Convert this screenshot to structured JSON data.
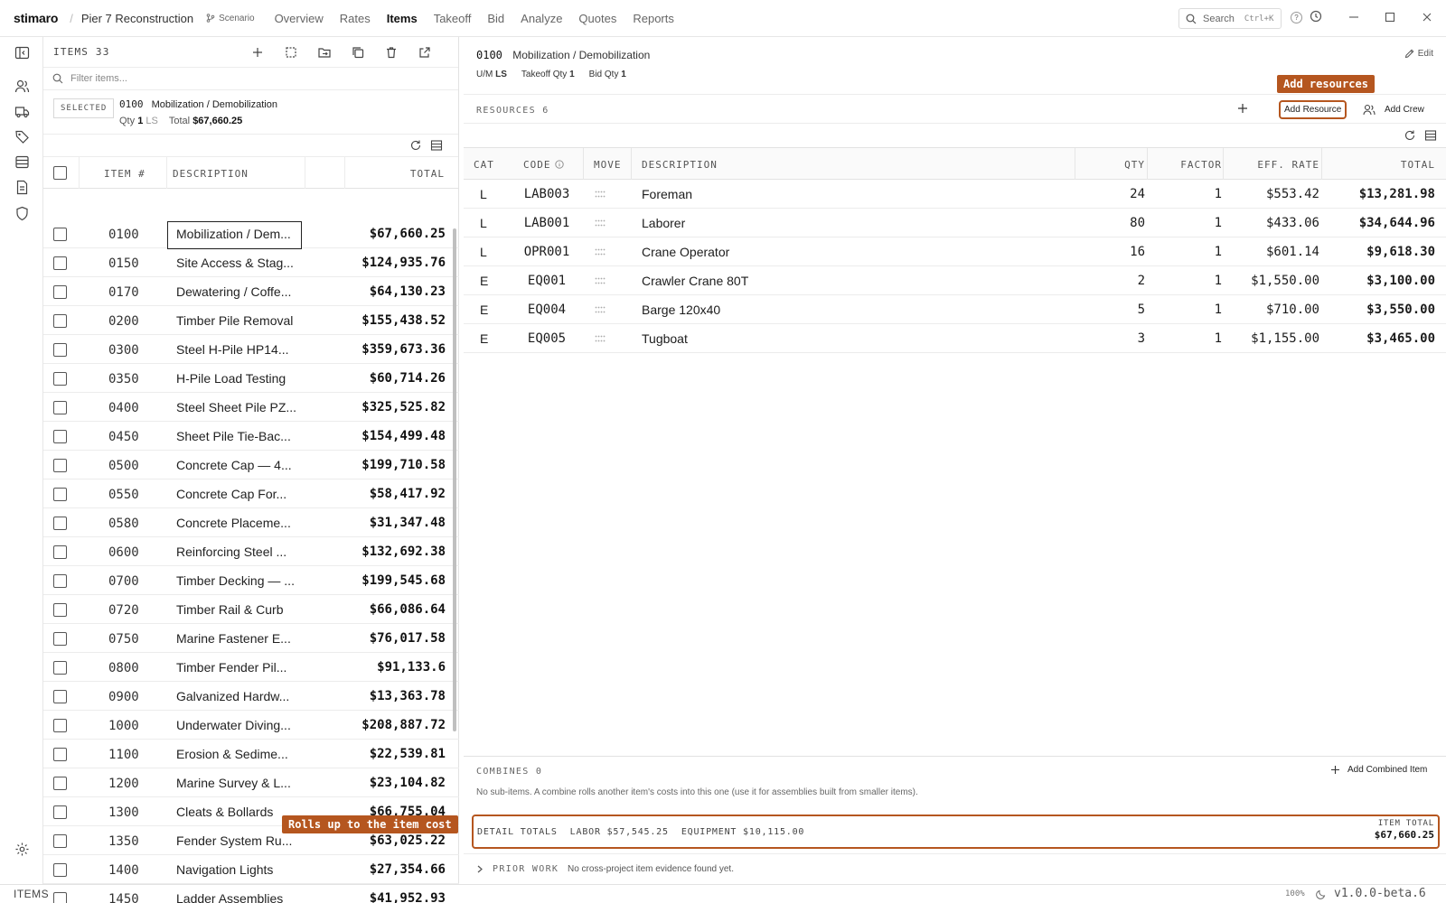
{
  "app": {
    "brand": "stimaro",
    "project": "Pier 7 Reconstruction",
    "scenario": "Scenario",
    "nav": [
      "Overview",
      "Rates",
      "Items",
      "Takeoff",
      "Bid",
      "Analyze",
      "Quotes",
      "Reports"
    ],
    "active_nav": "Items",
    "search_placeholder": "Search",
    "search_shortcut": "Ctrl+K",
    "help": "?"
  },
  "items_panel": {
    "count_label": "ITEMS 33",
    "filter_placeholder": "Filter items...",
    "selected_tag": "SELECTED",
    "selected_code": "0100",
    "selected_desc": "Mobilization / Demobilization",
    "selected_qty_label": "Qty",
    "selected_qty": "1",
    "selected_um": "LS",
    "selected_total_label": "Total",
    "selected_total": "$67,660.25",
    "columns": {
      "item": "ITEM #",
      "description": "DESCRIPTION",
      "total": "TOTAL"
    },
    "rows": [
      {
        "code": "0100",
        "desc": "Mobilization / Dem...",
        "total": "$67,660.25"
      },
      {
        "code": "0150",
        "desc": "Site Access & Stag...",
        "total": "$124,935.76"
      },
      {
        "code": "0170",
        "desc": "Dewatering / Coffe...",
        "total": "$64,130.23"
      },
      {
        "code": "0200",
        "desc": "Timber Pile Removal",
        "total": "$155,438.52"
      },
      {
        "code": "0300",
        "desc": "Steel H-Pile HP14...",
        "total": "$359,673.36"
      },
      {
        "code": "0350",
        "desc": "H-Pile Load Testing",
        "total": "$60,714.26"
      },
      {
        "code": "0400",
        "desc": "Steel Sheet Pile PZ...",
        "total": "$325,525.82"
      },
      {
        "code": "0450",
        "desc": "Sheet Pile Tie-Bac...",
        "total": "$154,499.48"
      },
      {
        "code": "0500",
        "desc": "Concrete Cap — 4...",
        "total": "$199,710.58"
      },
      {
        "code": "0550",
        "desc": "Concrete Cap For...",
        "total": "$58,417.92"
      },
      {
        "code": "0580",
        "desc": "Concrete Placeme...",
        "total": "$31,347.48"
      },
      {
        "code": "0600",
        "desc": "Reinforcing Steel ...",
        "total": "$132,692.38"
      },
      {
        "code": "0700",
        "desc": "Timber Decking — ...",
        "total": "$199,545.68"
      },
      {
        "code": "0720",
        "desc": "Timber Rail & Curb",
        "total": "$66,086.64"
      },
      {
        "code": "0750",
        "desc": "Marine Fastener E...",
        "total": "$76,017.58"
      },
      {
        "code": "0800",
        "desc": "Timber Fender Pil...",
        "total": "$91,133.6"
      },
      {
        "code": "0900",
        "desc": "Galvanized Hardw...",
        "total": "$13,363.78"
      },
      {
        "code": "1000",
        "desc": "Underwater Diving...",
        "total": "$208,887.72"
      },
      {
        "code": "1100",
        "desc": "Erosion & Sedime...",
        "total": "$22,539.81"
      },
      {
        "code": "1200",
        "desc": "Marine Survey & L...",
        "total": "$23,104.82"
      },
      {
        "code": "1300",
        "desc": "Cleats & Bollards",
        "total": "$66,755.04"
      },
      {
        "code": "1350",
        "desc": "Fender System Ru...",
        "total": "$63,025.22"
      },
      {
        "code": "1400",
        "desc": "Navigation Lights",
        "total": "$27,354.66"
      },
      {
        "code": "1450",
        "desc": "Ladder Assemblies",
        "total": "$41,952.93"
      }
    ]
  },
  "callouts": {
    "add_resources": "Add resources",
    "rolls_up": "Rolls up to the item cost"
  },
  "detail": {
    "code": "0100",
    "title": "Mobilization / Demobilization",
    "edit": "Edit",
    "um_label": "U/M",
    "um": "LS",
    "takeoff_label": "Takeoff Qty",
    "takeoff_qty": "1",
    "bid_label": "Bid Qty",
    "bid_qty": "1",
    "resources_label": "RESOURCES 6",
    "add_resource": "Add Resource",
    "add_crew": "Add Crew",
    "columns": {
      "cat": "CAT",
      "code": "CODE",
      "move": "MOVE",
      "description": "DESCRIPTION",
      "qty": "QTY",
      "factor": "FACTOR",
      "rate": "EFF. RATE",
      "total": "TOTAL"
    },
    "resources": [
      {
        "cat": "L",
        "code": "LAB003",
        "desc": "Foreman",
        "qty": "24",
        "factor": "1",
        "rate": "$553.42",
        "total": "$13,281.98"
      },
      {
        "cat": "L",
        "code": "LAB001",
        "desc": "Laborer",
        "qty": "80",
        "factor": "1",
        "rate": "$433.06",
        "total": "$34,644.96"
      },
      {
        "cat": "L",
        "code": "OPR001",
        "desc": "Crane Operator",
        "qty": "16",
        "factor": "1",
        "rate": "$601.14",
        "total": "$9,618.30"
      },
      {
        "cat": "E",
        "code": "EQ001",
        "desc": "Crawler Crane 80T",
        "qty": "2",
        "factor": "1",
        "rate": "$1,550.00",
        "total": "$3,100.00"
      },
      {
        "cat": "E",
        "code": "EQ004",
        "desc": "Barge 120x40",
        "qty": "5",
        "factor": "1",
        "rate": "$710.00",
        "total": "$3,550.00"
      },
      {
        "cat": "E",
        "code": "EQ005",
        "desc": "Tugboat",
        "qty": "3",
        "factor": "1",
        "rate": "$1,155.00",
        "total": "$3,465.00"
      }
    ],
    "combines_label": "COMBINES 0",
    "add_combined": "Add Combined Item",
    "combines_note": "No sub-items. A combine rolls another item's costs into this one (use it for assemblies built from smaller items).",
    "detail_totals_label": "DETAIL TOTALS",
    "labor_label": "LABOR",
    "labor_value": "$57,545.25",
    "equipment_label": "EQUIPMENT",
    "equipment_value": "$10,115.00",
    "item_total_label": "ITEM TOTAL",
    "item_total_value": "$67,660.25",
    "prior_work_label": "PRIOR WORK",
    "prior_work_note": "No cross-project item evidence found yet."
  },
  "status": {
    "left": "ITEMS",
    "zoom": "100%",
    "version": "v1.0.0-beta.6"
  },
  "colors": {
    "accent": "#b5561f",
    "text": "#1c1c1c",
    "border": "#e2e2e2"
  }
}
